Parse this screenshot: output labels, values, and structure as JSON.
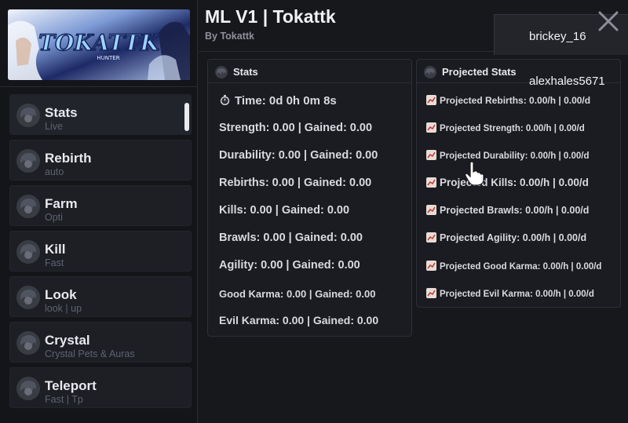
{
  "app": {
    "title": "ML V1 | Tokattk",
    "subtitle": "By Tokattk",
    "banner_text": "TOKATTK",
    "banner_subtext": "HUNTER"
  },
  "toast": {
    "line1": "brickey_16",
    "line2": "alexhales5671"
  },
  "sidebar": {
    "items": [
      {
        "label": "Stats",
        "sub": "Live"
      },
      {
        "label": "Rebirth",
        "sub": "auto"
      },
      {
        "label": "Farm",
        "sub": "Opti"
      },
      {
        "label": "Kill",
        "sub": "Fast"
      },
      {
        "label": "Look",
        "sub": "look | up"
      },
      {
        "label": "Crystal",
        "sub": "Crystal Pets & Auras"
      },
      {
        "label": "Teleport",
        "sub": "Fast | Tp"
      }
    ]
  },
  "stats_panel": {
    "title": "Stats",
    "time": "Time: 0d 0h 0m 8s",
    "rows": [
      "Strength: 0.00 | Gained: 0.00",
      "Durability: 0.00 | Gained: 0.00",
      "Rebirths: 0.00 | Gained: 0.00",
      "Kills: 0.00 | Gained: 0.00",
      "Brawls: 0.00 | Gained: 0.00",
      "Agility: 0.00 | Gained: 0.00",
      "Good Karma: 0.00 | Gained: 0.00",
      "Evil Karma: 0.00 | Gained: 0.00"
    ]
  },
  "projected_panel": {
    "title": "Projected Stats",
    "rows": [
      "Projected Rebirths: 0.00/h | 0.00/d",
      "Projected Strength: 0.00/h | 0.00/d",
      "Projected Durability: 0.00/h | 0.00/d",
      "Projected Kills: 0.00/h | 0.00/d",
      "Projected Brawls: 0.00/h | 0.00/d",
      "Projected Agility: 0.00/h | 0.00/d",
      "Projected Good Karma: 0.00/h | 0.00/d",
      "Projected Evil Karma: 0.00/h | 0.00/d"
    ]
  },
  "colors": {
    "background": "#17181c",
    "panel": "#1b1c21",
    "text": "#d9d9e0",
    "muted": "#5f6270",
    "active_indicator": "#e9e9ee"
  },
  "icons": {
    "nav_item": "character-avatar-icon",
    "time": "stopwatch-icon",
    "projected_row": "chart-increasing-icon",
    "close": "close-icon"
  }
}
